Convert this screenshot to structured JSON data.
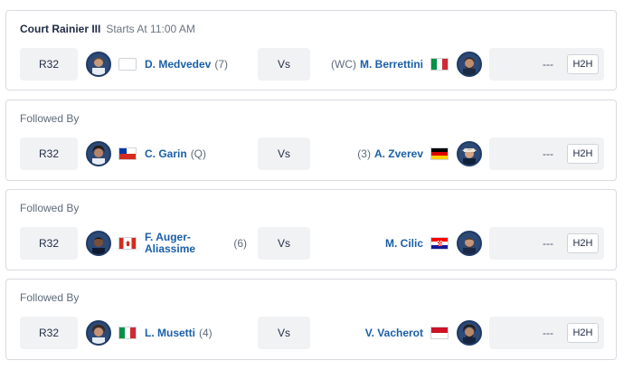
{
  "matches": [
    {
      "header_label": "Court Rainier III",
      "header_starts": "Starts At 11:00 AM",
      "round": "R32",
      "p1_name": "D. Medvedev",
      "p1_seed": "(7)",
      "p1_flag": "none",
      "vs": "Vs",
      "p2_seed": "(WC)",
      "p2_name": "M. Berrettini",
      "p2_flag": "italy",
      "score": "---",
      "h2h": "H2H"
    },
    {
      "header_label": "Followed By",
      "round": "R32",
      "p1_name": "C. Garin",
      "p1_seed": "(Q)",
      "p1_flag": "chile",
      "vs": "Vs",
      "p2_seed": "(3)",
      "p2_name": "A. Zverev",
      "p2_flag": "germany",
      "score": "---",
      "h2h": "H2H"
    },
    {
      "header_label": "Followed By",
      "round": "R32",
      "p1_name": "F. Auger-Aliassime",
      "p1_seed": "(6)",
      "p1_flag": "canada",
      "vs": "Vs",
      "p2_seed": "",
      "p2_name": "M. Cilic",
      "p2_flag": "croatia",
      "score": "---",
      "h2h": "H2H"
    },
    {
      "header_label": "Followed By",
      "round": "R32",
      "p1_name": "L. Musetti",
      "p1_seed": "(4)",
      "p1_flag": "italy",
      "vs": "Vs",
      "p2_seed": "",
      "p2_name": "V. Vacherot",
      "p2_flag": "monaco",
      "score": "---",
      "h2h": "H2H"
    }
  ],
  "colors": {
    "accent_name": "#1a5fa8",
    "cell_bg": "#f1f2f4",
    "border": "#d9dbe0"
  }
}
